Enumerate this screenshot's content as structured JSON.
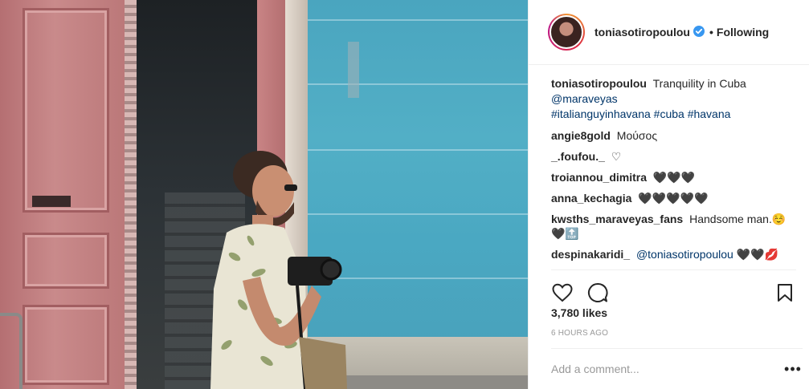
{
  "header": {
    "username": "toniasotiropoulou",
    "separator": "•",
    "follow_label": "Following"
  },
  "caption": {
    "username": "toniasotiropoulou",
    "text": "Tranquility in Cuba",
    "mention": "@maraveyas",
    "hashtags": "#italianguyinhavana #cuba #havana"
  },
  "comments": [
    {
      "username": "angie8gold",
      "text": "Μούσος"
    },
    {
      "username": "_.foufou._",
      "text": "♡"
    },
    {
      "username": "troiannou_dimitra",
      "text": "🖤🖤🖤"
    },
    {
      "username": "anna_kechagia",
      "text": "🖤🖤🖤🖤🖤"
    },
    {
      "username": "kwsths_maraveyas_fans",
      "text": "Handsome man.☺️",
      "text2": "🖤🔝"
    },
    {
      "username": "despinakaridi_",
      "mention": "@toniasotiropoulou",
      "text": "🖤🖤💋"
    }
  ],
  "actions": {
    "like_icon": "heart-icon",
    "comment_icon": "comment-bubble-icon",
    "save_icon": "bookmark-icon"
  },
  "likes": "3,780 likes",
  "timestamp": "6 HOURS AGO",
  "add_comment": {
    "placeholder": "Add a comment...",
    "more_icon": "more-options-icon"
  },
  "colors": {
    "link": "#003569",
    "verified": "#3897f0",
    "text": "#262626",
    "muted": "#999999"
  }
}
